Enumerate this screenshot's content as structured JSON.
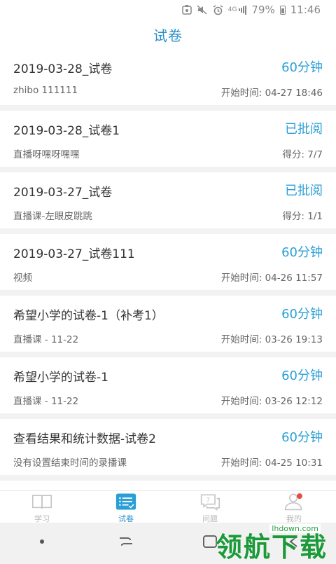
{
  "status_bar": {
    "network": "4G",
    "battery": "79%",
    "time": "11:46"
  },
  "app_bar": {
    "title": "试卷"
  },
  "papers": [
    {
      "title": "2019-03-28_试卷",
      "badge": "60分钟",
      "subtitle": "zhibo 111111",
      "meta": "开始时间: 04-27 18:46"
    },
    {
      "title": "2019-03-28_试卷1",
      "badge": "已批阅",
      "subtitle": "直播呀嘿呀嘿嘿",
      "meta": "得分: 7/7"
    },
    {
      "title": "2019-03-27_试卷",
      "badge": "已批阅",
      "subtitle": "直播课-左眼皮跳跳",
      "meta": "得分: 1/1"
    },
    {
      "title": "2019-03-27_试卷111",
      "badge": "60分钟",
      "subtitle": "视频",
      "meta": "开始时间: 04-26 11:57"
    },
    {
      "title": "希望小学的试卷-1（补考1）",
      "badge": "60分钟",
      "subtitle": "直播课 - 11-22",
      "meta": "开始时间: 03-26 19:13"
    },
    {
      "title": "希望小学的试卷-1",
      "badge": "60分钟",
      "subtitle": "直播课 - 11-22",
      "meta": "开始时间: 03-26 12:12"
    },
    {
      "title": "查看结果和统计数据-试卷2",
      "badge": "60分钟",
      "subtitle": "没有设置结束时间的录播课",
      "meta": "开始时间: 04-25 10:31"
    }
  ],
  "bottom_nav": {
    "items": [
      {
        "label": "学习",
        "icon": "book-icon",
        "active": false
      },
      {
        "label": "试卷",
        "icon": "list-icon",
        "active": true
      },
      {
        "label": "问题",
        "icon": "question-chat-icon",
        "active": false
      },
      {
        "label": "我的",
        "icon": "user-icon",
        "active": false
      }
    ]
  },
  "watermark": {
    "url": "lhdown.com",
    "text": "领航下载"
  },
  "colors": {
    "accent": "#2a8fc9",
    "badge": "#2a9fd6",
    "watermark": "#1c9a3a"
  }
}
